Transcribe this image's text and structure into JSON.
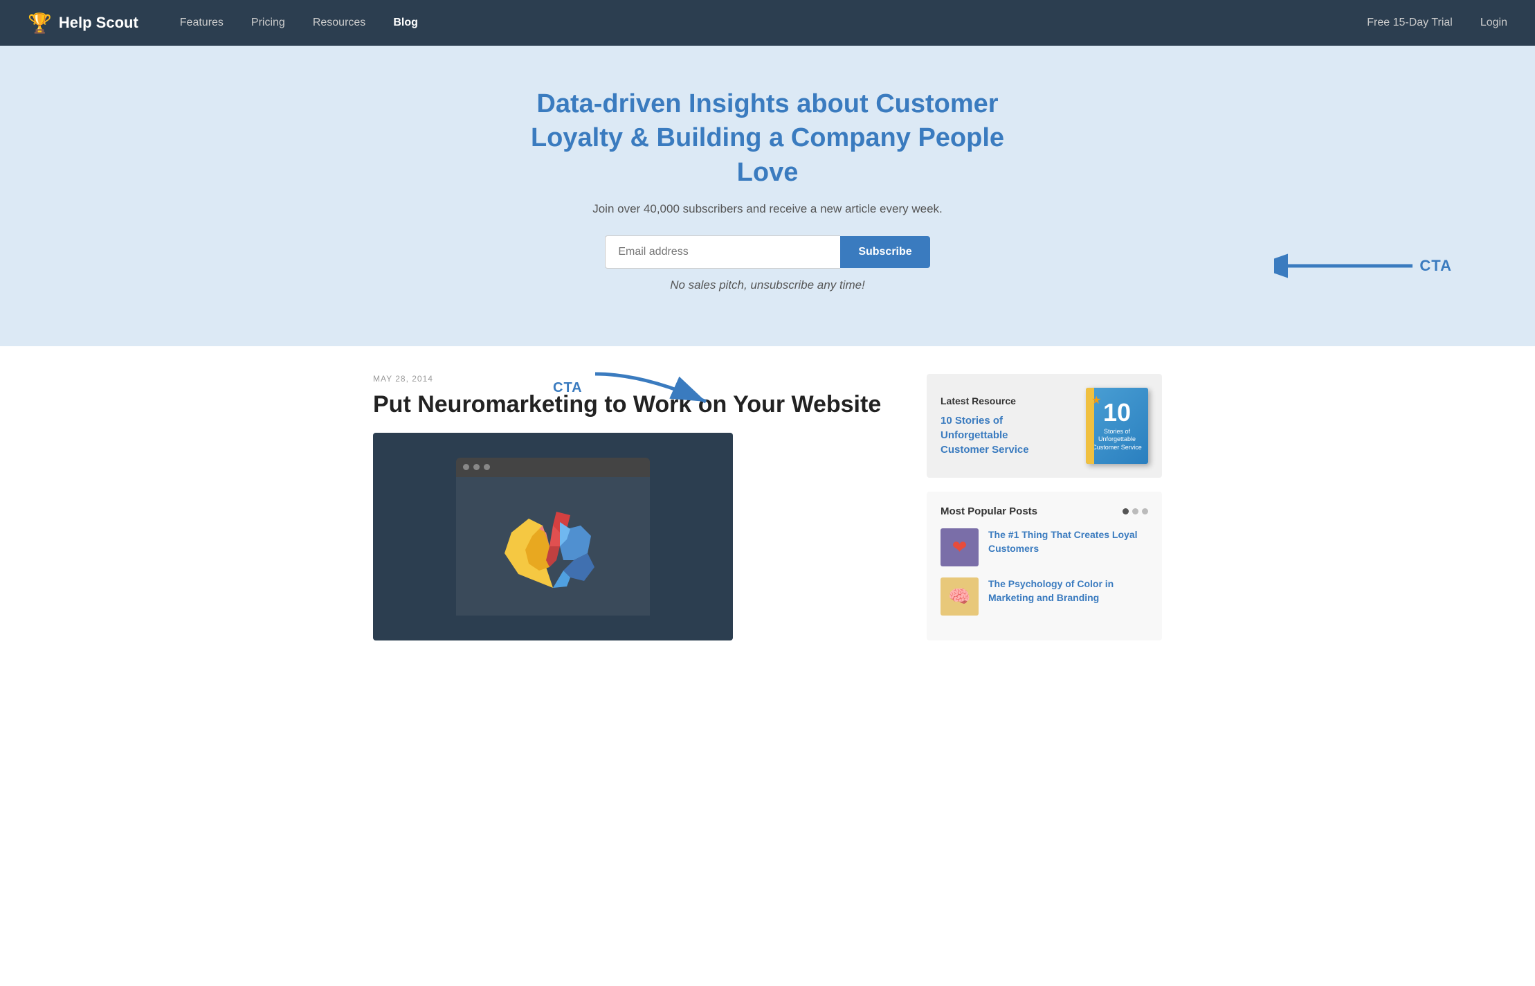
{
  "nav": {
    "logo_text": "Help Scout",
    "logo_icon": "🏆",
    "links": [
      {
        "label": "Features",
        "active": false
      },
      {
        "label": "Pricing",
        "active": false
      },
      {
        "label": "Resources",
        "active": false
      },
      {
        "label": "Blog",
        "active": true
      }
    ],
    "right_links": [
      {
        "label": "Free 15-Day Trial"
      },
      {
        "label": "Login"
      }
    ]
  },
  "hero": {
    "title": "Data-driven Insights about Customer Loyalty & Building a Company People Love",
    "subtitle": "Join over 40,000 subscribers and receive a new article every week.",
    "email_placeholder": "Email address",
    "subscribe_button": "Subscribe",
    "disclaimer": "No sales pitch, unsubscribe any time!",
    "cta_label": "CTA"
  },
  "article": {
    "date": "MAY 28, 2014",
    "title": "Put Neuromarketing to Work on Your Website",
    "cta_label": "CTA"
  },
  "sidebar": {
    "latest_resource": {
      "label": "Latest Resource",
      "link_text": "10 Stories of Unforgettable Customer Service",
      "book_number": "10",
      "book_subtitle": "Stories of\nUnforgettable\nCustomer Service"
    },
    "popular_posts": {
      "title": "Most Popular Posts",
      "posts": [
        {
          "title": "The #1 Thing That Creates Loyal Customers",
          "thumb_type": "heart"
        },
        {
          "title": "The Psychology of Color in Marketing and Branding",
          "thumb_type": "head"
        }
      ]
    }
  }
}
